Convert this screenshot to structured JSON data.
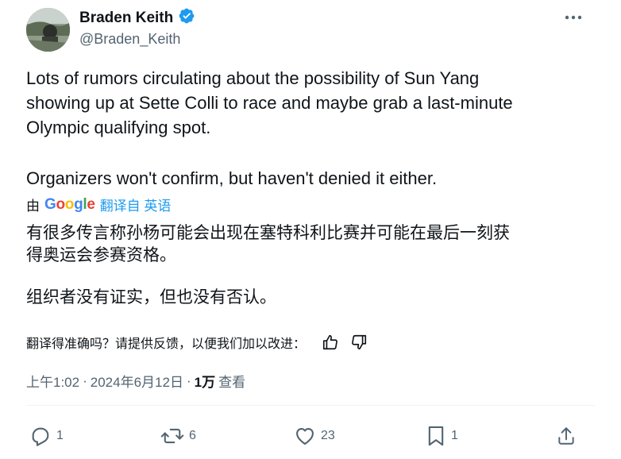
{
  "author": {
    "name": "Braden Keith",
    "handle": "@Braden_Keith",
    "verified": true,
    "verified_color": "#1d9bf0"
  },
  "tweet": {
    "lines": [
      "Lots of rumors circulating about the possibility of Sun Yang",
      "showing up at Sette Colli to race and maybe grab a last-minute",
      "Olympic qualifying spot.",
      "Organizers won't confirm, but haven't denied it either."
    ]
  },
  "translation": {
    "by_label": "由",
    "provider": "Google",
    "link_label": "翻译自 英语",
    "lines": [
      "有很多传言称孙杨可能会出现在塞特科利比赛并可能在最后一刻获",
      "得奥运会参赛资格。",
      "组织者没有证实，但也没有否认。"
    ],
    "feedback_prompt": "翻译得准确吗？请提供反馈，以便我们加以改进：",
    "feedback_icons": [
      "thumbs-up-icon",
      "thumbs-down-icon"
    ]
  },
  "meta": {
    "time": "上午1:02",
    "separator": "·",
    "date": "2024年6月12日",
    "views_count": "1万",
    "views_label": "查看"
  },
  "actions": {
    "replies": "1",
    "retweets": "6",
    "likes": "23",
    "bookmarks": "1"
  },
  "colors": {
    "text": "#0f1419",
    "secondary": "#536471",
    "link": "#1d9bf0"
  }
}
